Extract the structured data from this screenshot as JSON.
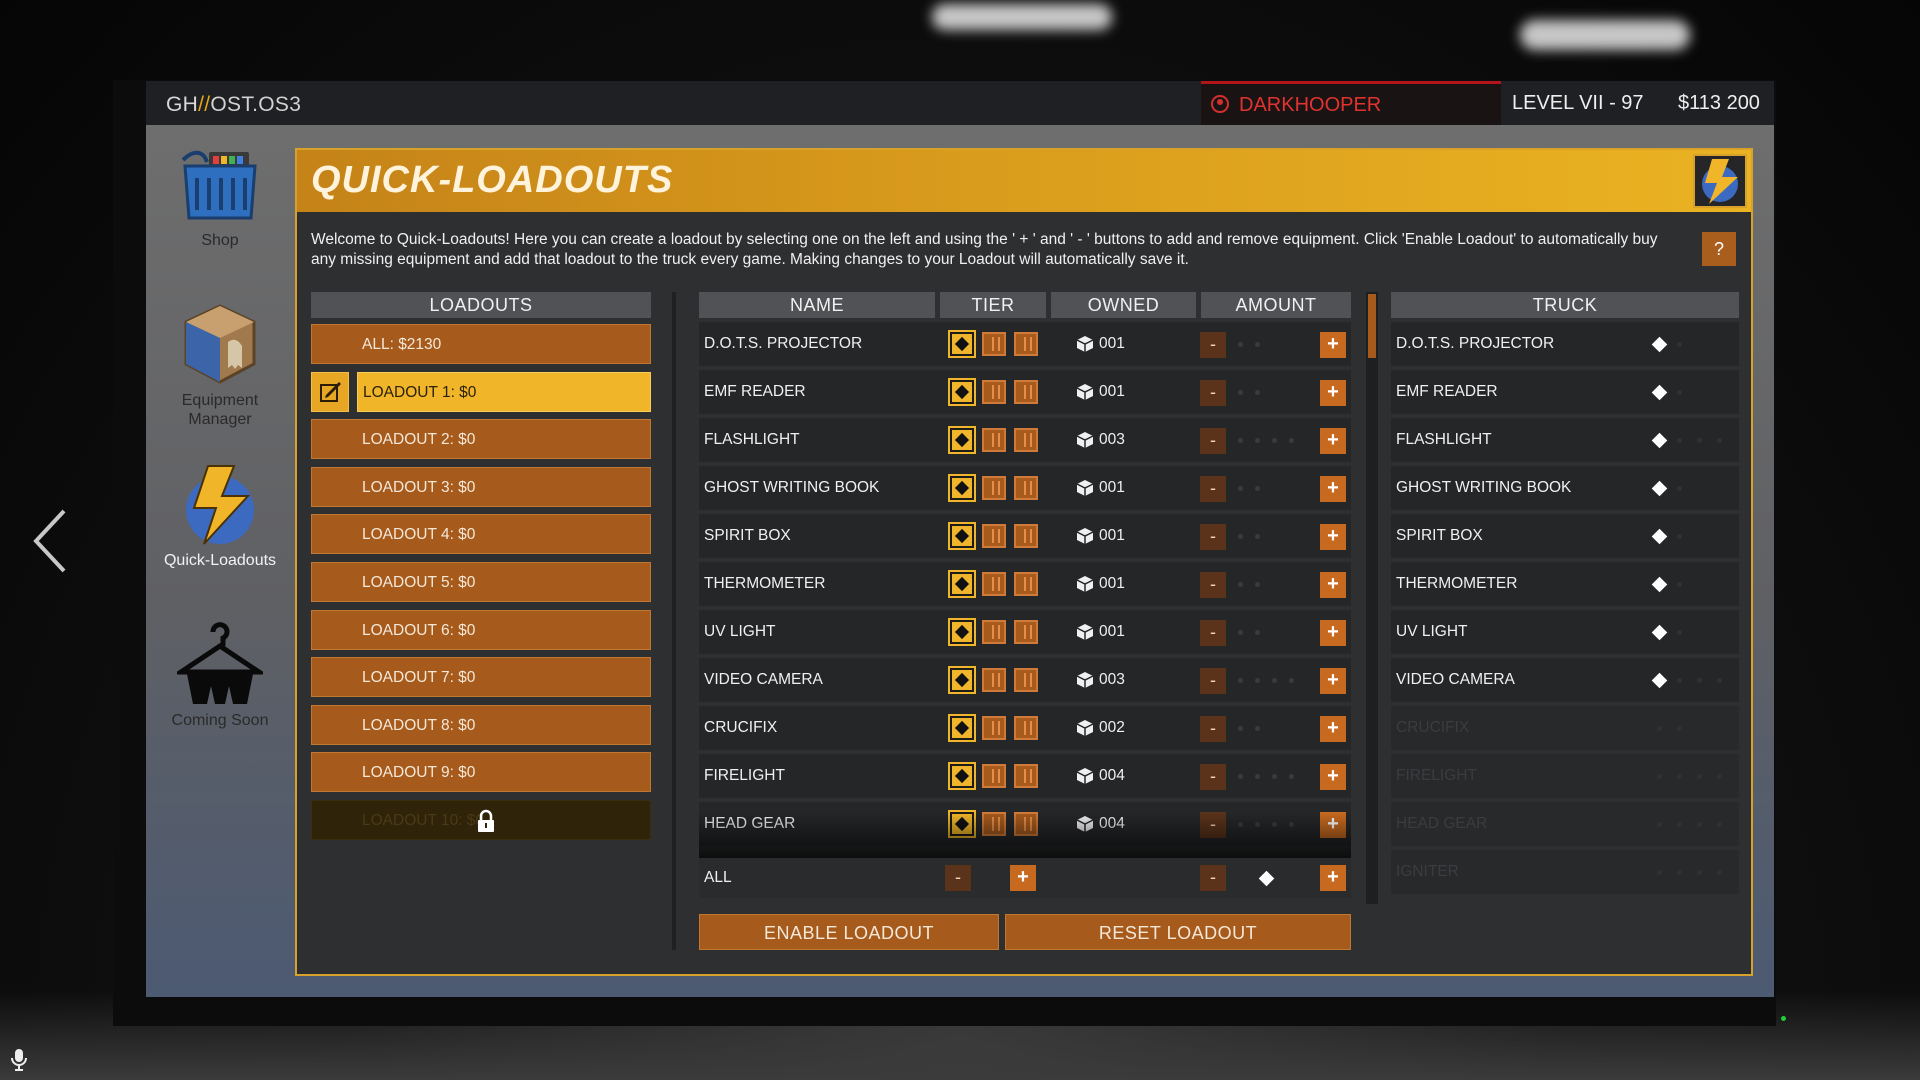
{
  "topbar": {
    "os_prefix": "GH",
    "os_sep": "//",
    "os_name": "OST.OS3",
    "username": "DARKHOOPER",
    "level": "LEVEL VII - 97",
    "money": "$113 200"
  },
  "nav": {
    "shop": "Shop",
    "equipment_manager": "Equipment Manager",
    "quick_loadouts": "Quick-Loadouts",
    "coming_soon": "Coming Soon"
  },
  "header": {
    "title": "QUICK-LOADOUTS",
    "intro": "Welcome to Quick-Loadouts! Here you can create a loadout by selecting one on the left and using the ' + ' and ' - ' buttons to add and remove equipment. Click 'Enable Loadout' to automatically buy any missing equipment and add that loadout to the truck every game. Making changes to your Loadout will automatically save it.",
    "help": "?"
  },
  "loadouts": {
    "heading": "LOADOUTS",
    "items": [
      {
        "label": "ALL: $2130"
      },
      {
        "label": "LOADOUT 1: $0"
      },
      {
        "label": "LOADOUT 2: $0"
      },
      {
        "label": "LOADOUT 3: $0"
      },
      {
        "label": "LOADOUT 4: $0"
      },
      {
        "label": "LOADOUT 5: $0"
      },
      {
        "label": "LOADOUT 6: $0"
      },
      {
        "label": "LOADOUT 7: $0"
      },
      {
        "label": "LOADOUT 8: $0"
      },
      {
        "label": "LOADOUT 9: $0"
      },
      {
        "label": "LOADOUT 10: $0"
      }
    ],
    "selected_index": 1,
    "locked_index": 10
  },
  "table": {
    "headers": {
      "name": "NAME",
      "tier": "TIER",
      "owned": "OWNED",
      "amount": "AMOUNT"
    },
    "rows": [
      {
        "name": "D.O.T.S. PROJECTOR",
        "owned": "001",
        "amount": 1,
        "max": 2
      },
      {
        "name": "EMF READER",
        "owned": "001",
        "amount": 1,
        "max": 2
      },
      {
        "name": "FLASHLIGHT",
        "owned": "003",
        "amount": 1,
        "max": 4
      },
      {
        "name": "GHOST WRITING BOOK",
        "owned": "001",
        "amount": 1,
        "max": 2
      },
      {
        "name": "SPIRIT BOX",
        "owned": "001",
        "amount": 1,
        "max": 2
      },
      {
        "name": "THERMOMETER",
        "owned": "001",
        "amount": 1,
        "max": 2
      },
      {
        "name": "UV LIGHT",
        "owned": "001",
        "amount": 1,
        "max": 2
      },
      {
        "name": "VIDEO CAMERA",
        "owned": "003",
        "amount": 1,
        "max": 4
      },
      {
        "name": "CRUCIFIX",
        "owned": "002",
        "amount": 0,
        "max": 2
      },
      {
        "name": "FIRELIGHT",
        "owned": "004",
        "amount": 0,
        "max": 4
      },
      {
        "name": "HEAD GEAR",
        "owned": "004",
        "amount": 0,
        "max": 4
      }
    ],
    "all_label": "ALL",
    "minus": "-",
    "plus": "+"
  },
  "buttons": {
    "enable": "ENABLE LOADOUT",
    "reset": "RESET LOADOUT"
  },
  "truck": {
    "heading": "TRUCK",
    "items": [
      {
        "name": "D.O.T.S. PROJECTOR",
        "filled": 1,
        "slots": 2
      },
      {
        "name": "EMF READER",
        "filled": 1,
        "slots": 2
      },
      {
        "name": "FLASHLIGHT",
        "filled": 1,
        "slots": 4
      },
      {
        "name": "GHOST WRITING BOOK",
        "filled": 1,
        "slots": 2
      },
      {
        "name": "SPIRIT BOX",
        "filled": 1,
        "slots": 2
      },
      {
        "name": "THERMOMETER",
        "filled": 1,
        "slots": 2
      },
      {
        "name": "UV LIGHT",
        "filled": 1,
        "slots": 2
      },
      {
        "name": "VIDEO CAMERA",
        "filled": 1,
        "slots": 4
      },
      {
        "name": "CRUCIFIX",
        "filled": 0,
        "slots": 2
      },
      {
        "name": "FIRELIGHT",
        "filled": 0,
        "slots": 4
      },
      {
        "name": "HEAD GEAR",
        "filled": 0,
        "slots": 4
      },
      {
        "name": "IGNITER",
        "filled": 0,
        "slots": 4
      }
    ]
  },
  "icons": {
    "shop": "shopping-basket-icon",
    "equipment": "equipment-box-icon",
    "quick_loadouts": "lightning-bolt-icon",
    "coming_soon": "clothes-hanger-icon"
  },
  "colors": {
    "accent": "#f0b528",
    "button": "#a65a1c",
    "user": "#e0332f"
  }
}
